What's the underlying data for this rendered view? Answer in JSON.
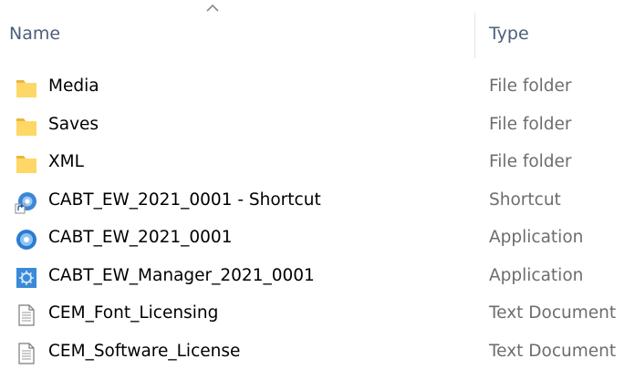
{
  "columns": {
    "name_label": "Name",
    "type_label": "Type",
    "sorted_by": "name",
    "sort_direction": "ascending"
  },
  "items": [
    {
      "name": "Media",
      "type": "File folder",
      "icon": "folder-icon"
    },
    {
      "name": "Saves",
      "type": "File folder",
      "icon": "folder-icon"
    },
    {
      "name": "XML",
      "type": "File folder",
      "icon": "folder-icon"
    },
    {
      "name": "CABT_EW_2021_0001 - Shortcut",
      "type": "Shortcut",
      "icon": "shortcut-app-icon"
    },
    {
      "name": "CABT_EW_2021_0001",
      "type": "Application",
      "icon": "app-disc-icon"
    },
    {
      "name": "CABT_EW_Manager_2021_0001",
      "type": "Application",
      "icon": "app-gear-icon"
    },
    {
      "name": "CEM_Font_Licensing",
      "type": "Text Document",
      "icon": "text-document-icon"
    },
    {
      "name": "CEM_Software_License",
      "type": "Text Document",
      "icon": "text-document-icon"
    }
  ],
  "colors": {
    "header_text": "#4c607a",
    "type_text": "#6d6d6d",
    "folder_yellow": "#ffd767",
    "app_blue": "#2b7bd1"
  }
}
